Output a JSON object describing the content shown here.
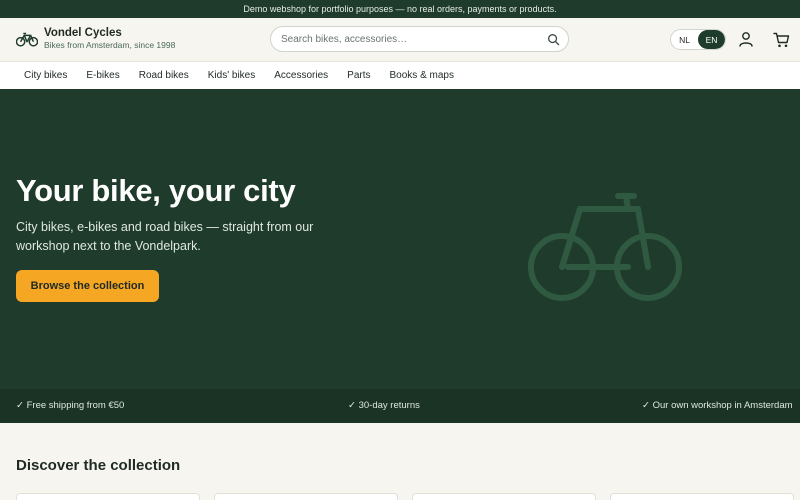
{
  "announcement": "Demo webshop for portfolio purposes — no real orders, payments or products.",
  "brand": {
    "name": "Vondel Cycles",
    "tagline": "Bikes from Amsterdam, since 1998",
    "icon": "bicycle-icon"
  },
  "search": {
    "placeholder": "Search bikes, accessories…",
    "value": "",
    "icon": "search-icon"
  },
  "language": {
    "options": [
      "NL",
      "EN"
    ],
    "selected": "EN"
  },
  "header_icons": [
    "user-icon",
    "cart-icon"
  ],
  "nav": {
    "items": [
      "City bikes",
      "E-bikes",
      "Road bikes",
      "Kids' bikes",
      "Accessories",
      "Parts",
      "Books & maps"
    ]
  },
  "hero": {
    "title": "Your bike, your city",
    "subtitle": "City bikes, e-bikes and road bikes — straight from our workshop next to the Vondelpark.",
    "cta": "Browse the collection",
    "illustration": "bicycle-icon"
  },
  "usps": [
    "✓ Free shipping from €50",
    "✓ 30-day returns",
    "✓ Our own workshop in Amsterdam"
  ],
  "discover": {
    "title": "Discover the collection"
  },
  "colors": {
    "primary": "#1f3b2b",
    "accent": "#f5a623",
    "background": "#f7f5ef"
  }
}
